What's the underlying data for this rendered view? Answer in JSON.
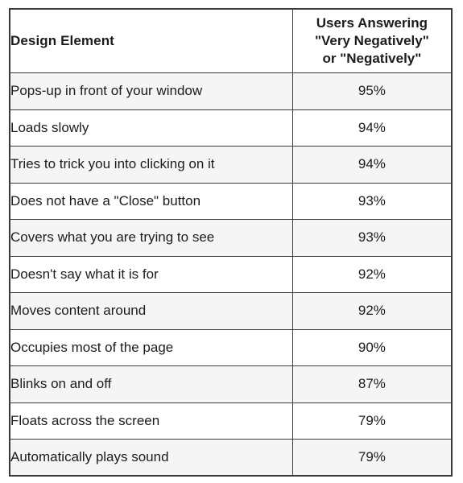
{
  "table": {
    "headers": {
      "element": "Design Element",
      "percent_lines": [
        "Users Answering",
        "\"Very Negatively\"",
        "or \"Negatively\""
      ],
      "percent_full": "Users Answering \"Very Negatively\" or \"Negatively\""
    },
    "rows": [
      {
        "element": "Pops-up in front of your window",
        "percent": "95%"
      },
      {
        "element": "Loads slowly",
        "percent": "94%"
      },
      {
        "element": "Tries to trick you into clicking on it",
        "percent": "94%"
      },
      {
        "element": "Does not have a \"Close\" button",
        "percent": "93%"
      },
      {
        "element": "Covers what you are trying to see",
        "percent": "93%"
      },
      {
        "element": "Doesn't say what it is for",
        "percent": "92%"
      },
      {
        "element": "Moves content around",
        "percent": "92%"
      },
      {
        "element": "Occupies most of the page",
        "percent": "90%"
      },
      {
        "element": "Blinks on and off",
        "percent": "87%"
      },
      {
        "element": "Floats across the screen",
        "percent": "79%"
      },
      {
        "element": "Automatically plays sound",
        "percent": "79%"
      }
    ]
  },
  "chart_data": {
    "type": "table",
    "title": "",
    "columns": [
      "Design Element",
      "Users Answering \"Very Negatively\" or \"Negatively\""
    ],
    "categories": [
      "Pops-up in front of your window",
      "Loads slowly",
      "Tries to trick you into clicking on it",
      "Does not have a \"Close\" button",
      "Covers what you are trying to see",
      "Doesn't say what it is for",
      "Moves content around",
      "Occupies most of the page",
      "Blinks on and off",
      "Floats across the screen",
      "Automatically plays sound"
    ],
    "values": [
      95,
      94,
      94,
      93,
      93,
      92,
      92,
      90,
      87,
      79,
      79
    ],
    "unit": "%",
    "xlabel": "",
    "ylabel": "",
    "ylim": [
      0,
      100
    ],
    "grid": false,
    "legend": "none"
  },
  "style": {
    "border_color": "#3a3a3a",
    "shade_color": "#f5f5f5",
    "page_background": "#ffffff",
    "text_color": "#1c1c1c"
  }
}
